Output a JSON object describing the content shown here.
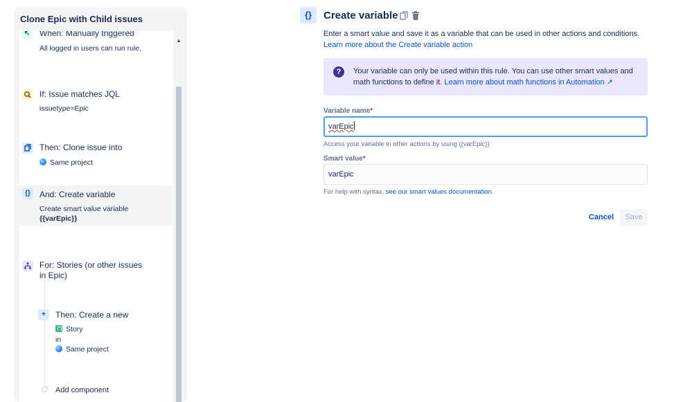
{
  "panel": {
    "title": "Clone Epic with Child issues",
    "items": [
      {
        "title": "When: Manually triggered",
        "sub": "All logged in users can run rule."
      },
      {
        "title": "If: Issue matches JQL",
        "sub": "issuetype=Epic"
      },
      {
        "title": "Then: Clone issue into",
        "sub": "Same project"
      },
      {
        "title": "And: Create variable",
        "sub": "Create smart value variable",
        "sub_bold": "{{varEpic}}"
      },
      {
        "title_line1": "For: Stories (or other issues",
        "title_line2": "in Epic)"
      },
      {
        "title": "Then: Create a new",
        "issue_type": "Story",
        "in_label": "in",
        "project": "Same project"
      },
      {
        "title": "Add component"
      }
    ]
  },
  "config": {
    "icon_text": "{}",
    "title": "Create variable",
    "description": "Enter a smart value and save it as a variable that can be used in other actions and conditions.",
    "description_link": "Learn more about the Create variable action",
    "info": {
      "text": "Your variable can only be used within this rule. You can use other smart values and math functions to define it.",
      "link": "Learn more about math functions in Automation ↗"
    },
    "variable_name": {
      "label": "Variable name",
      "required_mark": "*",
      "value": "varEpic",
      "help": "Access your variable in other actions by using {{varEpic}}"
    },
    "smart_value": {
      "label": "Smart value",
      "required_mark": "*",
      "value": "varEpic",
      "help": "For help with syntax,",
      "help_link": "see our smart values documentation."
    },
    "cancel_label": "Cancel",
    "save_label": "Save"
  }
}
